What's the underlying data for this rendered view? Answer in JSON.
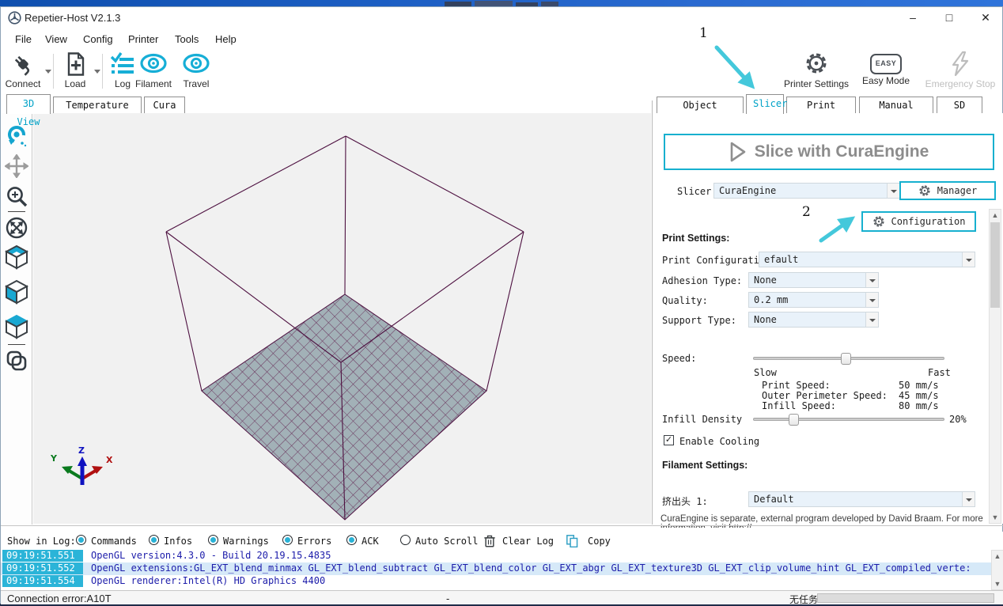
{
  "window": {
    "title": "Repetier-Host V2.1.3",
    "minimize": "–",
    "maximize": "□",
    "close": "✕"
  },
  "menu": {
    "items": [
      "File",
      "View",
      "Config",
      "Printer",
      "Tools",
      "Help"
    ]
  },
  "toolbar": {
    "connect": "Connect",
    "load": "Load",
    "log": "Log",
    "filament": "Filament",
    "travel": "Travel",
    "printer_settings": "Printer Settings",
    "easy_mode": "Easy Mode",
    "easy_badge": "EASY",
    "emergency_stop": "Emergency Stop"
  },
  "left_tabs": {
    "items": [
      "3D View",
      "Temperature Curve",
      "Cura"
    ],
    "active": "3D View"
  },
  "right_tabs": {
    "items": [
      "Object Placement",
      "Slicer",
      "Print Preview",
      "Manual Control",
      "SD Card"
    ],
    "active": "Slicer"
  },
  "annotations": {
    "step1": "1",
    "step2": "2",
    "arrow_color": "#44c8db"
  },
  "slicer_panel": {
    "slice_button": "Slice with CuraEngine",
    "slicer_label": "Slicer:",
    "slicer_value": "CuraEngine",
    "manager_button": "Manager",
    "configuration_button": "Configuration",
    "print_settings_heading": "Print Settings:",
    "print_configuration_label": "Print Configuration:",
    "print_configuration_value": "efault",
    "adhesion_label": "Adhesion Type:",
    "adhesion_value": "None",
    "quality_label": "Quality:",
    "quality_value": "0.2 mm",
    "support_label": "Support Type:",
    "support_value": "None",
    "speed_label": "Speed:",
    "speed_slow": "Slow",
    "speed_fast": "Fast",
    "speed_rows": [
      {
        "label": "Print Speed:",
        "value": "50 mm/s"
      },
      {
        "label": "Outer Perimeter Speed:",
        "value": "45 mm/s"
      },
      {
        "label": "Infill Speed:",
        "value": "80 mm/s"
      }
    ],
    "infill_label": "Infill Density",
    "infill_value": "20%",
    "enable_cooling": "Enable Cooling",
    "check_glyph": "✓",
    "filament_settings_heading": "Filament Settings:",
    "extruder_label": "挤出头 1:",
    "extruder_value": "Default",
    "footer_line1": "CuraEngine is separate, external program developed by David Braam. For more",
    "footer_line2": "information, visit http://..."
  },
  "log": {
    "show_in_log": "Show in Log:",
    "toggles": [
      {
        "label": "Commands"
      },
      {
        "label": "Infos"
      },
      {
        "label": "Warnings"
      },
      {
        "label": "Errors"
      },
      {
        "label": "ACK"
      },
      {
        "label": "Auto Scroll"
      }
    ],
    "clear_log": "Clear Log",
    "copy": "Copy",
    "entries": [
      {
        "time": "09:19:51.551",
        "text": "OpenGL version:4.3.0 - Build 20.19.15.4835"
      },
      {
        "time": "09:19:51.552",
        "text": "OpenGL extensions:GL_EXT_blend_minmax GL_EXT_blend_subtract GL_EXT_blend_color GL_EXT_abgr GL_EXT_texture3D GL_EXT_clip_volume_hint GL_EXT_compiled_verte:"
      },
      {
        "time": "09:19:51.554",
        "text": "OpenGL renderer:Intel(R) HD Graphics 4400"
      }
    ]
  },
  "status_bar": {
    "left": "Connection error:A10T",
    "center": "-",
    "task": "无任务"
  },
  "colors": {
    "accent": "#00a2c7",
    "log_timestamp_bg": "#2bb4d8",
    "log_text": "#1c1caa",
    "bed_fill": "#a2b1b7",
    "wireframe": "#4d1040",
    "button_border": "#17b0cf"
  }
}
